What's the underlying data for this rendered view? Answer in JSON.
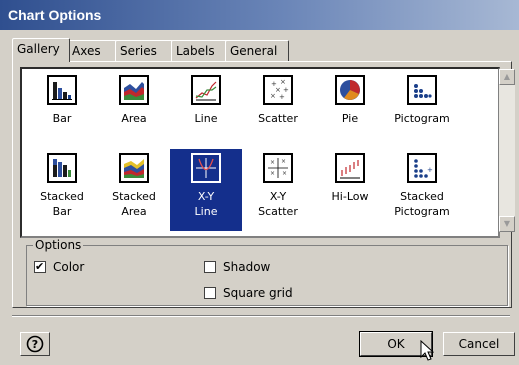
{
  "dialog": {
    "title": "Chart Options"
  },
  "tabs": [
    {
      "label": "Gallery"
    },
    {
      "label": "Axes"
    },
    {
      "label": "Series"
    },
    {
      "label": "Labels"
    },
    {
      "label": "General"
    }
  ],
  "gallery": {
    "row1": [
      {
        "label": "Bar",
        "icon": "bar-chart-icon"
      },
      {
        "label": "Area",
        "icon": "area-chart-icon"
      },
      {
        "label": "Line",
        "icon": "line-chart-icon"
      },
      {
        "label": "Scatter",
        "icon": "scatter-chart-icon"
      },
      {
        "label": "Pie",
        "icon": "pie-chart-icon"
      },
      {
        "label": "Pictogram",
        "icon": "pictogram-chart-icon"
      }
    ],
    "row2": [
      {
        "label1": "Stacked",
        "label2": "Bar",
        "icon": "stacked-bar-chart-icon"
      },
      {
        "label1": "Stacked",
        "label2": "Area",
        "icon": "stacked-area-chart-icon"
      },
      {
        "label1": "X-Y",
        "label2": "Line",
        "icon": "xy-line-chart-icon",
        "selected": true
      },
      {
        "label1": "X-Y",
        "label2": "Scatter",
        "icon": "xy-scatter-chart-icon"
      },
      {
        "label1": "Hi-Low",
        "label2": "",
        "icon": "hi-low-chart-icon"
      },
      {
        "label1": "Stacked",
        "label2": "Pictogram",
        "icon": "stacked-pictogram-chart-icon"
      }
    ]
  },
  "options": {
    "legend": "Options",
    "color": {
      "label": "Color",
      "checked": true
    },
    "shadow": {
      "label": "Shadow",
      "checked": false
    },
    "square_grid": {
      "label": "Square grid",
      "checked": false
    }
  },
  "buttons": {
    "help": "?",
    "ok": "OK",
    "cancel": "Cancel"
  }
}
